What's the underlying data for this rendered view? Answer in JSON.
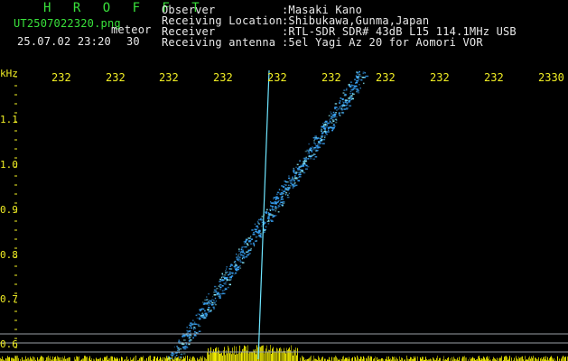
{
  "header": {
    "title_letters": "H R O F F T",
    "filename": "UT2507022320.png",
    "filetype": "meteor",
    "date_time": "25.07.02 23:20",
    "number": "30"
  },
  "station": {
    "observer_label": "Observer",
    "observer_value": ":Masaki Kano",
    "location_label": "Receiving Location",
    "location_value": ":Shibukawa,Gunma,Japan",
    "receiver_label": "Receiver",
    "receiver_value": ":RTL-SDR SDR# 43dB L15 114.1MHz USB",
    "antenna_label": "Receiving antenna",
    "antenna_value": ":5el Yagi Az 20 for Aomori VOR"
  },
  "axis": {
    "y_unit": "kHz",
    "y_ticks": [
      "1.1",
      "1.0",
      "0.9",
      "0.8",
      "0.7",
      "0.6"
    ],
    "x_ticks": [
      "232",
      "232",
      "232",
      "232",
      "232",
      "232",
      "232",
      "232",
      "232",
      "2330"
    ]
  },
  "colors": {
    "background": "#000000",
    "title": "#39e13b",
    "text": "#e9e9e9",
    "axis": "#f1ee24",
    "trail": "#3aa8ff",
    "trail_bright": "#8ef3ff",
    "noise": "#f5f000"
  }
}
